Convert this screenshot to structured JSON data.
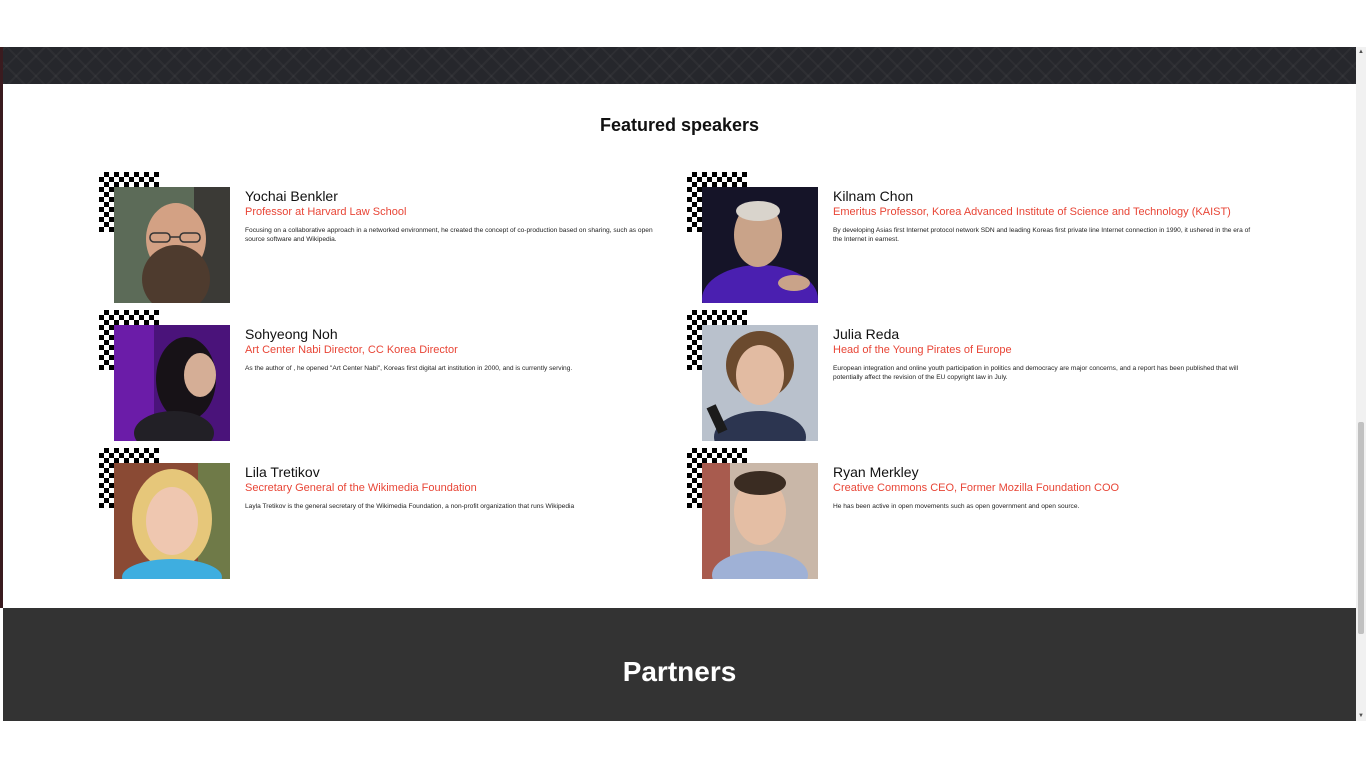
{
  "featured": {
    "title": "Featured speakers",
    "speakers": [
      {
        "name": "Yochai Benkler",
        "role": "Professor at Harvard Law School",
        "description": "Focusing on a collaborative approach in a networked environment, he created the concept of co-production based on sharing, such as open source software and Wikipedia."
      },
      {
        "name": "Kilnam Chon",
        "role": "Emeritus Professor, Korea Advanced Institute of Science and Technology (KAIST)",
        "description": "By developing Asias first Internet protocol network SDN and leading Koreas first private line Internet connection in 1990, it ushered in the era of the Internet in earnest."
      },
      {
        "name": "Sohyeong Noh",
        "role": "Art Center Nabi Director, CC Korea Director",
        "description": "As the author of , he opened \"Art Center Nabi\", Koreas first digital art institution in 2000, and is currently serving."
      },
      {
        "name": "Julia Reda",
        "role": "Head of the Young Pirates of Europe",
        "description": "European integration and online youth participation in politics and democracy are major concerns, and a report has been published that will potentially affect the revision of the EU copyright law in July."
      },
      {
        "name": "Lila Tretikov",
        "role": "Secretary General of the Wikimedia Foundation",
        "description": "Layla Tretikov is the general secretary of the Wikimedia Foundation, a non-profit organization that runs Wikipedia"
      },
      {
        "name": "Ryan Merkley",
        "role": "Creative Commons CEO, Former Mozilla Foundation COO",
        "description": "He has been active in open movements such as open government and open source."
      }
    ]
  },
  "partners": {
    "title": "Partners"
  },
  "colors": {
    "accent": "#e84536",
    "dark_band": "#333333",
    "header_band": "#26272c"
  },
  "icons": {
    "scroll_up": "▲",
    "scroll_down": "▼"
  }
}
